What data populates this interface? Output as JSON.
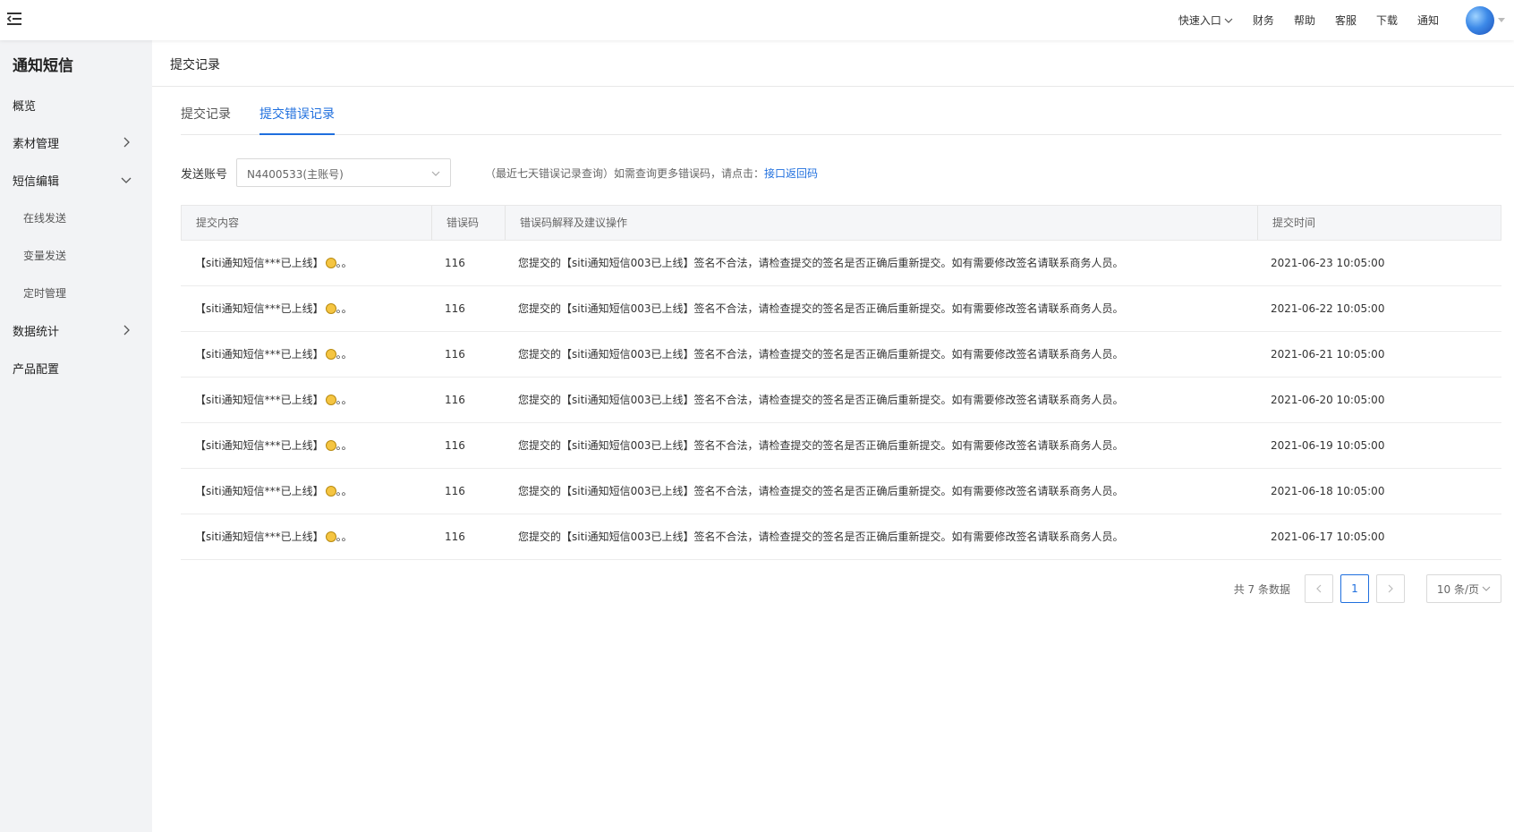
{
  "topbar": {
    "nav": [
      "快速入口",
      "财务",
      "帮助",
      "客服",
      "下载",
      "通知"
    ]
  },
  "sidebar": {
    "title": "通知短信",
    "items": [
      {
        "label": "概览"
      },
      {
        "label": "素材管理"
      },
      {
        "label": "短信编辑"
      },
      {
        "label": "在线发送"
      },
      {
        "label": "变量发送"
      },
      {
        "label": "定时管理"
      },
      {
        "label": "数据统计"
      },
      {
        "label": "产品配置"
      }
    ]
  },
  "page": {
    "title": "提交记录",
    "tabs": [
      "提交记录",
      "提交错误记录"
    ]
  },
  "filter": {
    "label": "发送账号",
    "value": "N4400533(主账号)",
    "hint": "（最近七天错误记录查询）如需查询更多错误码，请点击：",
    "link": "接口返回码"
  },
  "table": {
    "headers": [
      "提交内容",
      "错误码",
      "错误码解释及建议操作",
      "提交时间"
    ],
    "rows": [
      {
        "content": "【siti通知短信***已上线】",
        "suffix": "。。",
        "code": "116",
        "explain": "您提交的【siti通知短信003已上线】签名不合法，请检查提交的签名是否正确后重新提交。如有需要修改签名请联系商务人员。",
        "time": "2021-06-23 10:05:00"
      },
      {
        "content": "【siti通知短信***已上线】",
        "suffix": "。。",
        "code": "116",
        "explain": "您提交的【siti通知短信003已上线】签名不合法，请检查提交的签名是否正确后重新提交。如有需要修改签名请联系商务人员。",
        "time": "2021-06-22 10:05:00"
      },
      {
        "content": "【siti通知短信***已上线】",
        "suffix": "。。",
        "code": "116",
        "explain": "您提交的【siti通知短信003已上线】签名不合法，请检查提交的签名是否正确后重新提交。如有需要修改签名请联系商务人员。",
        "time": "2021-06-21 10:05:00"
      },
      {
        "content": "【siti通知短信***已上线】",
        "suffix": "。。",
        "code": "116",
        "explain": "您提交的【siti通知短信003已上线】签名不合法，请检查提交的签名是否正确后重新提交。如有需要修改签名请联系商务人员。",
        "time": "2021-06-20 10:05:00"
      },
      {
        "content": "【siti通知短信***已上线】",
        "suffix": "。。",
        "code": "116",
        "explain": "您提交的【siti通知短信003已上线】签名不合法，请检查提交的签名是否正确后重新提交。如有需要修改签名请联系商务人员。",
        "time": "2021-06-19 10:05:00"
      },
      {
        "content": "【siti通知短信***已上线】",
        "suffix": "。。",
        "code": "116",
        "explain": "您提交的【siti通知短信003已上线】签名不合法，请检查提交的签名是否正确后重新提交。如有需要修改签名请联系商务人员。",
        "time": "2021-06-18 10:05:00"
      },
      {
        "content": "【siti通知短信***已上线】",
        "suffix": "。。",
        "code": "116",
        "explain": "您提交的【siti通知短信003已上线】签名不合法，请检查提交的签名是否正确后重新提交。如有需要修改签名请联系商务人员。",
        "time": "2021-06-17 10:05:00"
      }
    ]
  },
  "pagination": {
    "total": "共 7 条数据",
    "current": "1",
    "page_size": "10 条/页"
  }
}
